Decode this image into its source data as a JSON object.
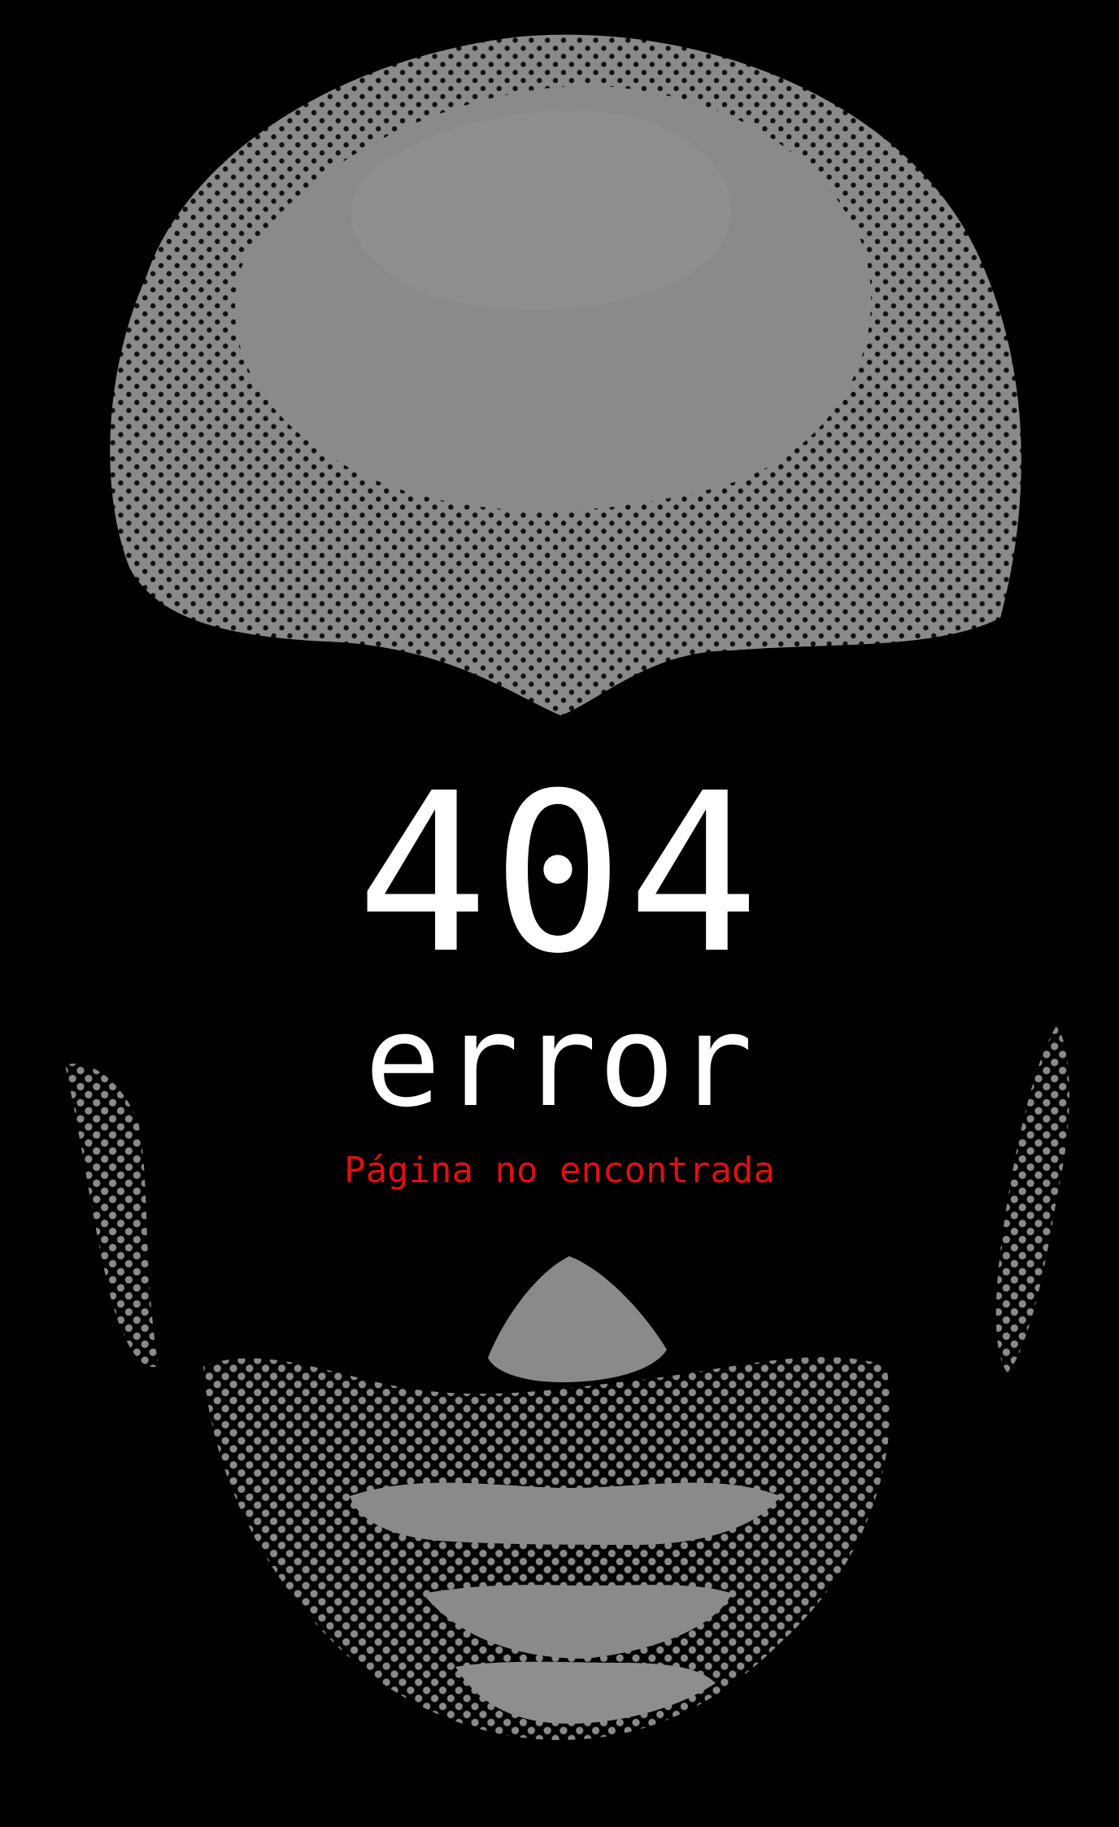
{
  "error": {
    "code": "404",
    "word": "error",
    "message": "Página no encontrada"
  },
  "illustration": {
    "description_icon": "halftone-face-illustration",
    "colors": {
      "background": "#000000",
      "halftone": "#8a8a8a",
      "shadow": "#3a3a3a",
      "text": "#ffffff",
      "accent": "#e10f0f"
    }
  }
}
